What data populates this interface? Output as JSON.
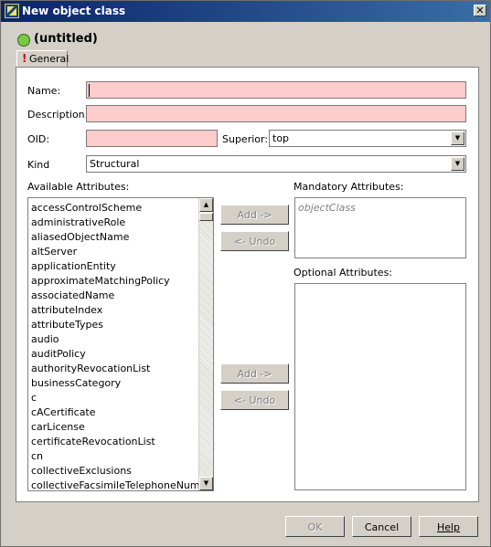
{
  "window": {
    "title": "New object class",
    "close_glyph": "✕",
    "app_icon": "directory-app-icon"
  },
  "header": {
    "status_color": "#7bc843",
    "title": "(untitled)"
  },
  "tabs": [
    {
      "label": "General",
      "warning": "!"
    }
  ],
  "form": {
    "name_label": "Name:",
    "name_value": "",
    "description_label": "Description:",
    "description_value": "",
    "oid_label": "OID:",
    "oid_value": "",
    "superior_label": "Superior:",
    "superior_value": "top",
    "kind_label": "Kind",
    "kind_value": "Structural",
    "required_field_color": "#ffcccc"
  },
  "available": {
    "label": "Available Attributes:",
    "items": [
      "accessControlScheme",
      "administrativeRole",
      "aliasedObjectName",
      "altServer",
      "applicationEntity",
      "approximateMatchingPolicy",
      "associatedName",
      "attributeIndex",
      "attributeTypes",
      "audio",
      "auditPolicy",
      "authorityRevocationList",
      "businessCategory",
      "c",
      "cACertificate",
      "carLicense",
      "certificateRevocationList",
      "cn",
      "collectiveExclusions",
      "collectiveFacsimileTelephoneNumber"
    ]
  },
  "mandatory": {
    "label": "Mandatory Attributes:",
    "items": [
      "objectClass"
    ],
    "add_label": "Add ->",
    "undo_label": "<- Undo"
  },
  "optional": {
    "label": "Optional Attributes:",
    "items": [],
    "add_label": "Add ->",
    "undo_label": "<- Undo"
  },
  "footer": {
    "ok_label": "OK",
    "cancel_label": "Cancel",
    "help_label": "Help"
  }
}
